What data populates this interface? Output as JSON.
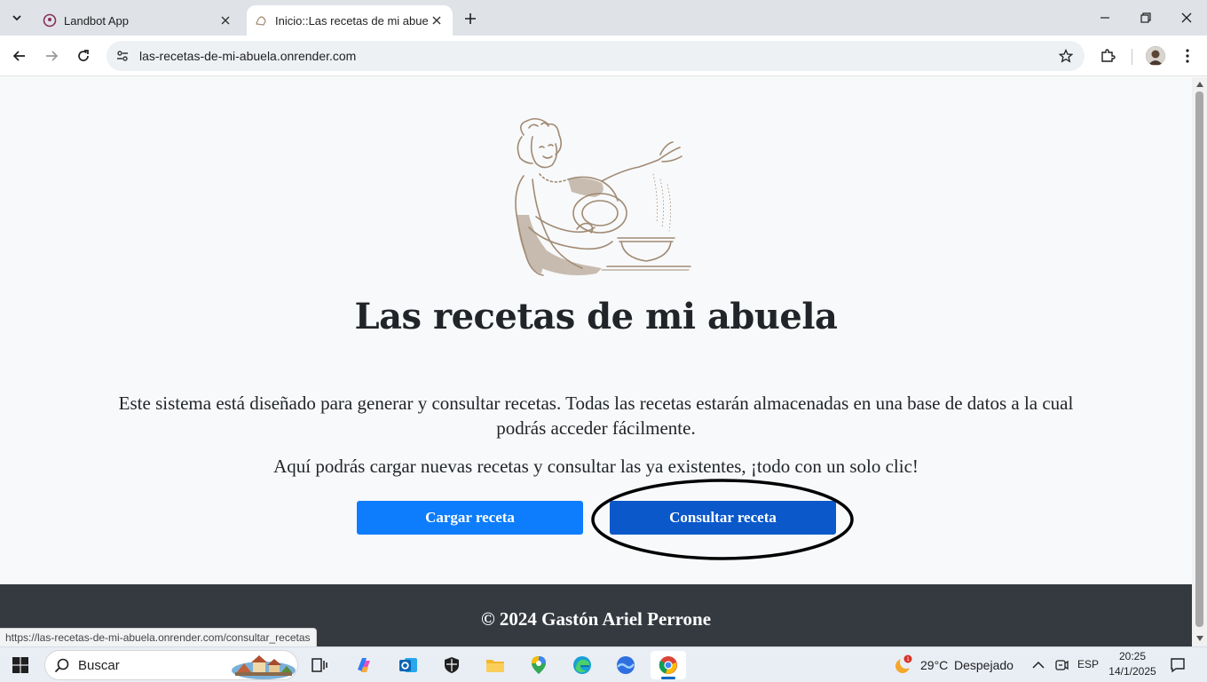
{
  "browser": {
    "tabs": [
      {
        "title": "Landbot App",
        "active": false
      },
      {
        "title": "Inicio::Las recetas de mi abuela",
        "active": true
      }
    ],
    "url": "las-recetas-de-mi-abuela.onrender.com",
    "status_url": "https://las-recetas-de-mi-abuela.onrender.com/consultar_recetas"
  },
  "page": {
    "title": "Las recetas de mi abuela",
    "description": "Este sistema está diseñado para generar y consultar recetas. Todas las recetas estarán almacenadas en una base de datos a la cual podrás acceder fácilmente.",
    "tagline": "Aquí podrás cargar nuevas recetas y consultar las ya existentes, ¡todo con un solo clic!",
    "buttons": {
      "load": "Cargar receta",
      "query": "Consultar receta"
    },
    "footer": "© 2024 Gastón Ariel Perrone"
  },
  "colors": {
    "primary_button": "#0d7dfd",
    "query_button": "#0a58ca",
    "footer_bg": "#343a40",
    "illustration": "#a08a74"
  },
  "taskbar": {
    "search_placeholder": "Buscar",
    "weather_temp": "29°C",
    "weather_desc": "Despejado",
    "weather_badge": "1",
    "language": "ESP",
    "time": "20:25",
    "date": "14/1/2025"
  }
}
